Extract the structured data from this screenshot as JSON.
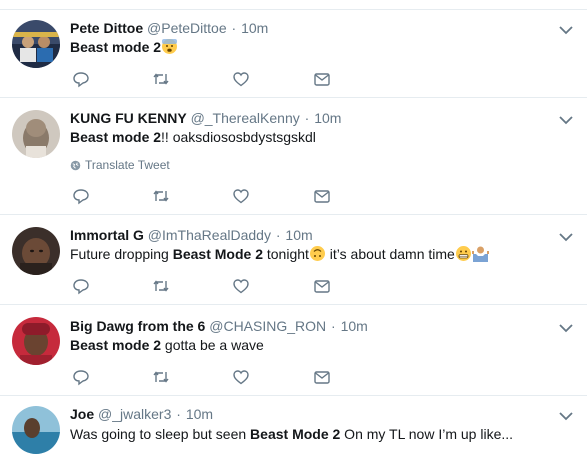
{
  "tweets": [
    {
      "name": "Pete Dittoe",
      "handle": "@PeteDittoe",
      "sep": "·",
      "time": "10m",
      "parts": [
        {
          "t": "Beast mode 2",
          "b": true
        }
      ]
    },
    {
      "name": "KUNG FU KENNY",
      "handle": "@_TherealKenny",
      "sep": "·",
      "time": "10m",
      "parts": [
        {
          "t": "Beast mode 2",
          "b": true
        },
        {
          "t": "!! oaksdiososbdystsgskdl",
          "b": false
        }
      ],
      "translate": "Translate Tweet"
    },
    {
      "name": "Immortal G",
      "handle": "@ImThaRealDaddy",
      "sep": "·",
      "time": "10m",
      "parts": [
        {
          "t": "Future dropping ",
          "b": false
        },
        {
          "t": "Beast Mode 2",
          "b": true
        },
        {
          "t": " tonight",
          "b": false
        },
        {
          "t": " it’s about damn time",
          "b": false
        }
      ]
    },
    {
      "name": "Big Dawg from the 6",
      "handle": "@CHASING_RON",
      "sep": "·",
      "time": "10m",
      "parts": [
        {
          "t": "Beast mode 2",
          "b": true
        },
        {
          "t": " gotta be a wave",
          "b": false
        }
      ]
    },
    {
      "name": "Joe",
      "handle": "@_jwalker3",
      "sep": "·",
      "time": "10m",
      "parts": [
        {
          "t": "Was going to sleep but seen ",
          "b": false
        },
        {
          "t": "Beast Mode 2",
          "b": true
        },
        {
          "t": " On my TL  now I’m up like...",
          "b": false
        }
      ]
    }
  ],
  "icons": [
    "reply-icon",
    "retweet-icon",
    "like-icon",
    "direct-message-icon"
  ],
  "colors": {
    "text": "#14171a",
    "secondary": "#657786",
    "border": "#e6ecf0"
  }
}
